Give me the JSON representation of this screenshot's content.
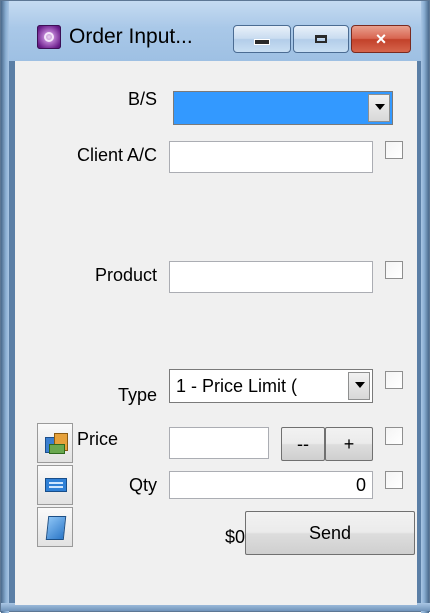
{
  "window": {
    "title": "Order Input...",
    "icon": "app-gear-icon",
    "controls": {
      "minimize": "minimize-icon",
      "maximize": "maximize-icon",
      "close": "×"
    }
  },
  "form": {
    "bs": {
      "label": "B/S",
      "value": "",
      "highlight_color": "#3399ff"
    },
    "client_ac": {
      "label": "Client A/C",
      "value": ""
    },
    "product": {
      "label": "Product",
      "value": ""
    },
    "type": {
      "label": "Type",
      "value": "1 - Price Limit ("
    },
    "price": {
      "label": "Price",
      "value": "",
      "decrement_label": "--",
      "increment_label": "+"
    },
    "qty": {
      "label": "Qty",
      "value": "0"
    },
    "amount": "$0",
    "send_label": "Send"
  },
  "tools": [
    "chart-icon",
    "keyboard-icon",
    "notebook-icon"
  ]
}
